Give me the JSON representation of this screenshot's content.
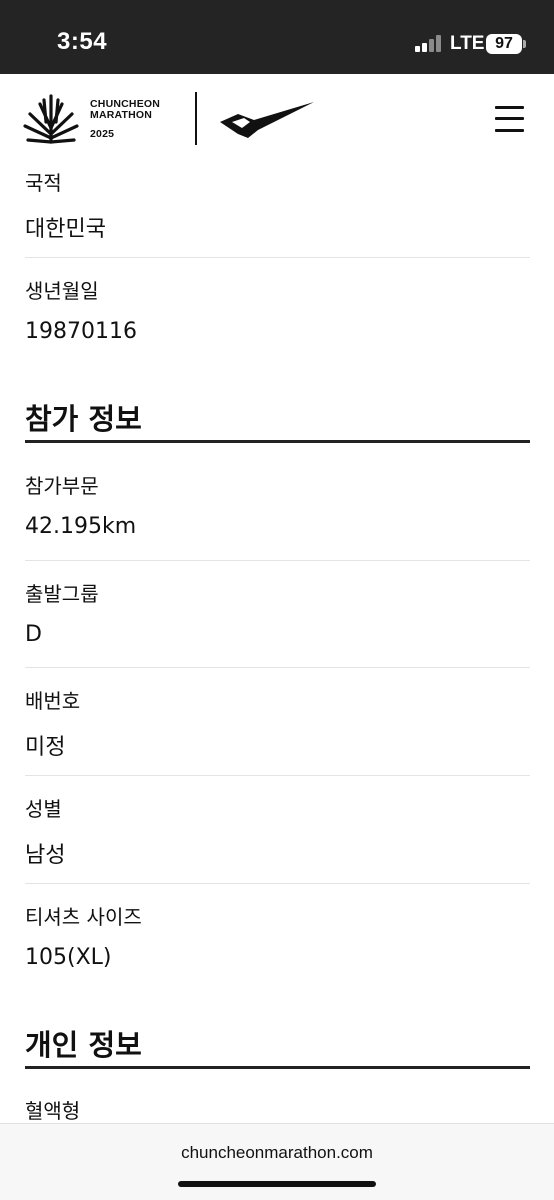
{
  "status_bar": {
    "time": "3:54",
    "network": "LTE",
    "battery": "97"
  },
  "header": {
    "logo_line1": "CHUNCHEON",
    "logo_line2": "MARATHON",
    "logo_year": "2025",
    "menu_icon": "hamburger-menu-icon"
  },
  "personal_top": {
    "nationality_label": "국적",
    "nationality_value": "대한민국",
    "birthdate_label": "생년월일",
    "birthdate_value": "19870116"
  },
  "participation": {
    "title": "참가 정보",
    "fields": [
      {
        "label": "참가부문",
        "value": "42.195km"
      },
      {
        "label": "출발그룹",
        "value": "D"
      },
      {
        "label": "배번호",
        "value": "미정"
      },
      {
        "label": "성별",
        "value": "남성"
      },
      {
        "label": "티셔츠 사이즈",
        "value": "105(XL)"
      }
    ]
  },
  "personal_info": {
    "title": "개인 정보",
    "blood_type_label": "혈액형"
  },
  "browser": {
    "url": "chuncheonmarathon.com"
  },
  "colors": {
    "status_bar_bg": "#242424",
    "text": "#111111",
    "divider": "#e4e4e4"
  }
}
